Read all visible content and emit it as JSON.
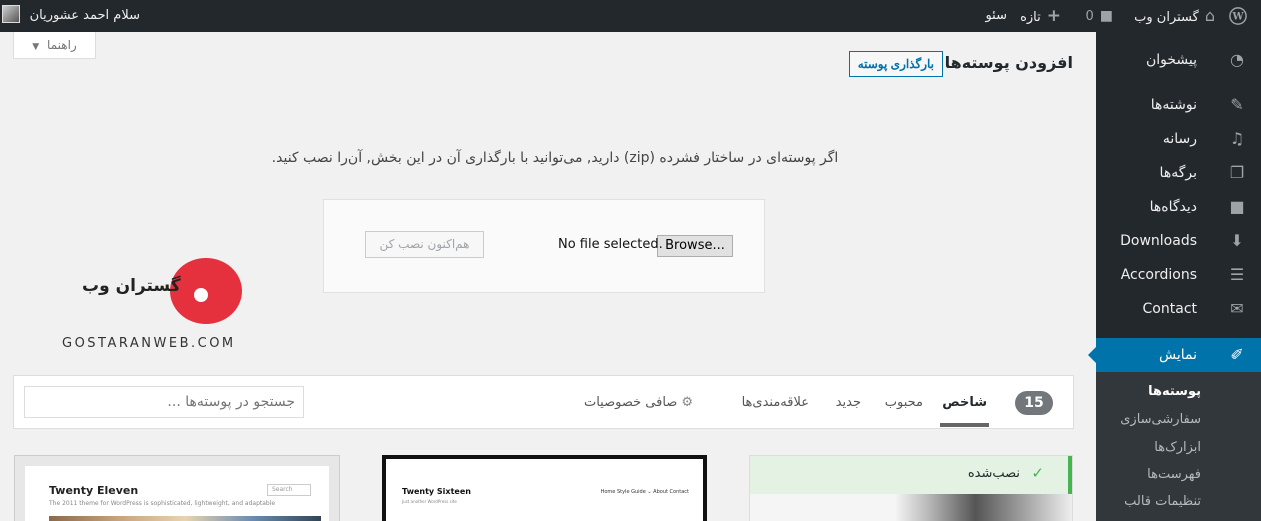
{
  "adminbar": {
    "site_name": "گستران وب",
    "comments_count": "0",
    "new_label": "تازه",
    "seo_label": "سئو",
    "greeting": "سلام احمد عشوریان"
  },
  "help_tab": {
    "label": "راهنما"
  },
  "page": {
    "title": "افزودن پوسته‌ها",
    "upload_button": "بارگذاری پوسته",
    "description": "اگر پوسته‌ای در ساختار فشرده (zip) دارید, می‌توانید با بارگذاری آن در این بخش, آن‌را نصب کنید."
  },
  "upload": {
    "browse_label": "Browse...",
    "file_status": "No file selected.",
    "install_label": "هم‌اکنون نصب کن"
  },
  "logo": {
    "text_fa": "گستران وب",
    "text_en": "GOSTARANWEB.COM"
  },
  "sidebar": {
    "items": [
      {
        "label": "پیشخوان",
        "icon": "dashboard-icon"
      },
      {
        "label": "نوشته‌ها",
        "icon": "pin-icon"
      },
      {
        "label": "رسانه",
        "icon": "media-icon"
      },
      {
        "label": "برگه‌ها",
        "icon": "pages-icon"
      },
      {
        "label": "دیدگاه‌ها",
        "icon": "comment-icon"
      },
      {
        "label": "Downloads",
        "icon": "download-icon"
      },
      {
        "label": "Accordions",
        "icon": "list-icon"
      },
      {
        "label": "Contact",
        "icon": "envelope-icon"
      },
      {
        "label": "نمایش",
        "icon": "brush-icon"
      }
    ],
    "submenu": [
      "پوسته‌ها",
      "سفارشی‌سازی",
      "ابزارک‌ها",
      "فهرست‌ها",
      "تنظیمات قالب"
    ]
  },
  "filter": {
    "count": "15",
    "tabs": [
      "شاخص",
      "محبوب",
      "جدید",
      "علاقه‌مندی‌ها"
    ],
    "feature_filter": "صافی خصوصیات",
    "search_placeholder": "جستجو در پوسته‌ها ..."
  },
  "themes": {
    "eleven": {
      "title": "Twenty Eleven",
      "desc": "The 2011 theme for WordPress is sophisticated, lightweight, and adaptable",
      "search": "Search"
    },
    "sixteen": {
      "title": "Twenty Sixteen",
      "desc": "Just another WordPress site",
      "nav": "Home   Style Guide ⌄   About   Contact"
    },
    "installed": {
      "label": "نصب‌شده"
    }
  }
}
